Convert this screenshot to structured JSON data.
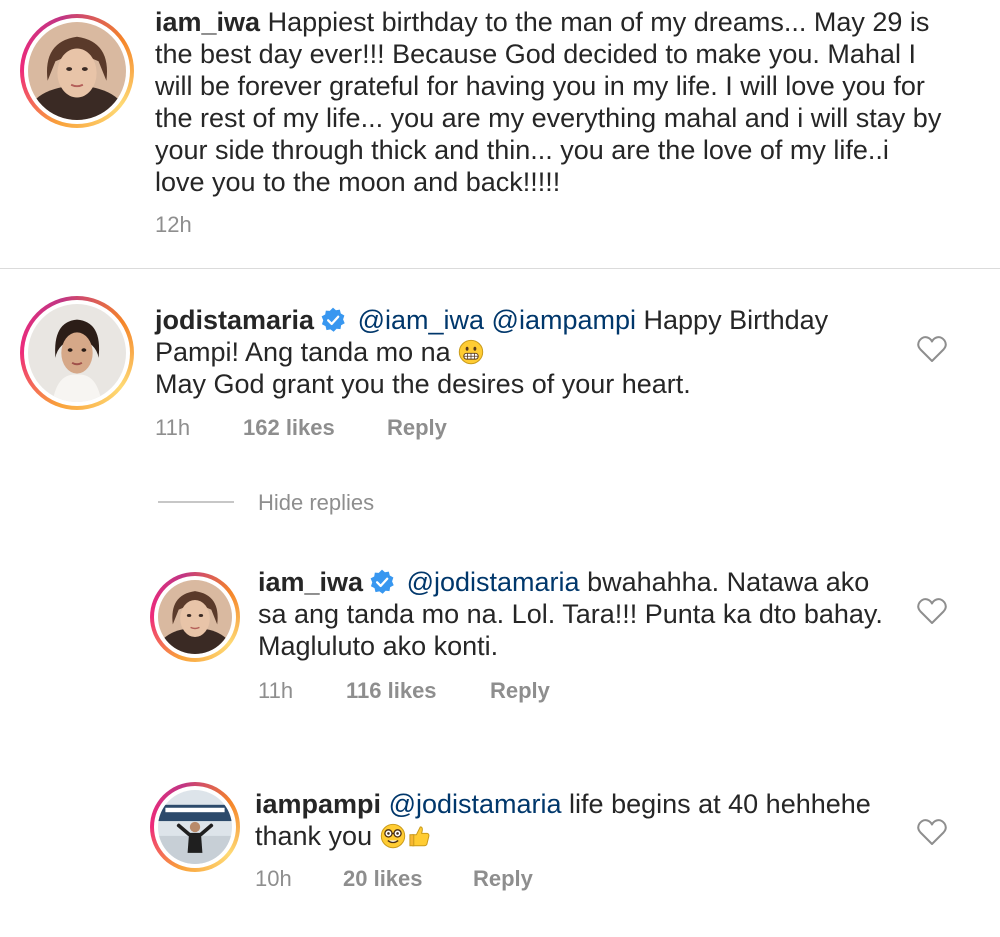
{
  "comments": [
    {
      "username": "iam_iwa",
      "text": "Happiest birthday to the man of my dreams... May 29 is the best day ever!!! Because God decided to make you. Mahal I will be forever grateful for having you in my life. I will love you for the rest of my life... you are my everything mahal and i will stay by your side through thick and thin... you are the love of my life..i love you to the moon and back!!!!!",
      "time": "12h"
    },
    {
      "username": "jodistamaria",
      "verified": true,
      "mentions": [
        "@iam_iwa",
        "@iampampi"
      ],
      "text_line1": "Happy Birthday",
      "text_line2": "Pampi! Ang tanda mo na",
      "text_line3": "May God grant you the desires of your heart.",
      "emoji": "grimacing-face",
      "time": "11h",
      "likes": "162 likes",
      "reply_label": "Reply"
    }
  ],
  "hide_replies_label": "Hide replies",
  "replies": [
    {
      "username": "iam_iwa",
      "verified": true,
      "mention": "@jodistamaria",
      "text_line1": "bwahahha. Natawa ako",
      "text_line2": "sa ang tanda mo na. Lol. Tara!!! Punta ka dto bahay.",
      "text_line3": "Magluluto ako konti.",
      "time": "11h",
      "likes": "116 likes",
      "reply_label": "Reply"
    },
    {
      "username": "iampampi",
      "mention": "@jodistamaria",
      "text_line1": "life begins at 40 hehhehe",
      "text_line2": "thank you",
      "emojis": [
        "nerd-face-with-glasses",
        "thumbs-up"
      ],
      "time": "10h",
      "likes": "20 likes",
      "reply_label": "Reply"
    }
  ],
  "colors": {
    "text": "#262626",
    "meta": "#8e8e8e",
    "mention": "#00376b",
    "verified": "#3897f0"
  }
}
